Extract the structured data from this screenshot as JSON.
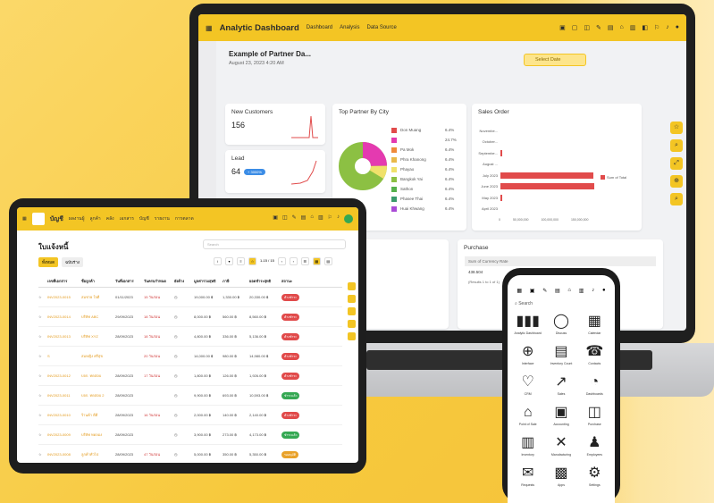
{
  "laptop": {
    "app_title": "Analytic Dashboard",
    "nav": [
      "Dashboard",
      "Analysis",
      "Data Source"
    ],
    "page_title": "Example of Partner Da...",
    "page_date": "August 23, 2023 4:20 AM",
    "select_date": "Select Date",
    "kpi": [
      {
        "label": "New Customers",
        "value": "156"
      },
      {
        "label": "Lead",
        "value": "64",
        "badge": "+ 3000%"
      }
    ],
    "top_partner": {
      "title": "Top Partner By City",
      "items": [
        {
          "name": "Don Muang",
          "pct": "6.4%",
          "color": "#e14b4b"
        },
        {
          "name": "",
          "pct": "24.7%",
          "color": "#e43ab0"
        },
        {
          "name": "Pa Mok",
          "pct": "6.4%",
          "color": "#ef8a3a"
        },
        {
          "name": "Phra Khanong",
          "pct": "6.4%",
          "color": "#e9b94a"
        },
        {
          "name": "Phayao",
          "pct": "6.4%",
          "color": "#f0e16b"
        },
        {
          "name": "Bangkok Yai",
          "pct": "6.4%",
          "color": "#8cc043"
        },
        {
          "name": "Sathon",
          "pct": "6.4%",
          "color": "#56b14c"
        },
        {
          "name": "Phasee Thai",
          "pct": "6.4%",
          "color": "#3a9b6b"
        },
        {
          "name": "Huai Khwang",
          "pct": "6.4%",
          "color": "#a94bd6"
        }
      ]
    },
    "sales_order": {
      "title": "Sales Order",
      "legend": "Sum of Total",
      "categories": [
        "Novembe...",
        "October...",
        "Septembe...",
        "August ...",
        "July 2023",
        "June 2023",
        "May 2023",
        "April 2023"
      ],
      "values": [
        0,
        0,
        2000000,
        0,
        148000000,
        150000000,
        1000000,
        0
      ],
      "ticks": [
        "0",
        "50,000,000",
        "100,000,000",
        "150,000,000"
      ]
    },
    "purchase": {
      "title": "Purchase",
      "label": "Sum of Currency Rate",
      "value": "438.504",
      "rows_text": "(Results 1 to 1 of 1)"
    }
  },
  "tablet": {
    "app_title": "บัญชี",
    "nav": [
      "ผลงานผู้",
      "ลูกค้า",
      "คลัง",
      "เอกสาร",
      "บัญชี",
      "รายงาน",
      "การตลาด"
    ],
    "page_title": "ใบแจ้งหนี้",
    "search_placeholder": "Search",
    "filters": [
      "ทั้งหมด",
      "ฉบับร่าง"
    ],
    "pager": "1-15 / 15",
    "columns": [
      "",
      "เลขที่เอกสาร",
      "ชื่อลูกค้า",
      "วันที่เอกสาร",
      "วันครบกำหนด",
      "ยังค้าง",
      "มูลค่ารวมสุทธิ",
      "ภาษี",
      "ยอดชำระสุทธิ",
      "สถานะ"
    ],
    "rows": [
      {
        "doc": "INV2023-0015",
        "cust": "สมชาย ใจดี",
        "date": "01/11/2023",
        "due": "15 วันก่อน",
        "amount": "19,000.00 ฿",
        "tax": "1,330.00 ฿",
        "net": "20,330.00 ฿",
        "status": "ค้างชำระ",
        "status_color": "#e14b4b"
      },
      {
        "doc": "INV2023-0014",
        "cust": "บริษัท ABC",
        "date": "29/09/2023",
        "due": "18 วันก่อน",
        "amount": "8,000.00 ฿",
        "tax": "560.00 ฿",
        "net": "8,560.00 ฿",
        "status": "ค้างชำระ",
        "status_color": "#e14b4b"
      },
      {
        "doc": "INV2023-0013",
        "cust": "บริษัท XYZ",
        "date": "28/09/2023",
        "due": "18 วันก่อน",
        "amount": "4,800.00 ฿",
        "tax": "336.00 ฿",
        "net": "5,136.00 ฿",
        "status": "ค้างชำระ",
        "status_color": "#e14b4b"
      },
      {
        "doc": "S",
        "cust": "สมหญิง ศรีสุข",
        "date": "",
        "due": "20 วันก่อน",
        "amount": "14,000.00 ฿",
        "tax": "980.00 ฿",
        "net": "14,980.00 ฿",
        "status": "ค้างชำระ",
        "status_color": "#e14b4b"
      },
      {
        "doc": "INV2023-0012",
        "cust": "บจก. ทดสอบ",
        "date": "28/09/2023",
        "due": "17 วันก่อน",
        "amount": "1,800.00 ฿",
        "tax": "126.00 ฿",
        "net": "1,926.00 ฿",
        "status": "ค้างชำระ",
        "status_color": "#e14b4b"
      },
      {
        "doc": "INV2023-0011",
        "cust": "บจก. ทดสอบ 2",
        "date": "28/09/2023",
        "due": "",
        "amount": "9,900.00 ฿",
        "tax": "693.00 ฿",
        "net": "10,593.00 ฿",
        "status": "ชำระแล้ว",
        "status_color": "#35a853"
      },
      {
        "doc": "INV2023-0010",
        "cust": "ร้านค้า ดีดี",
        "date": "28/09/2023",
        "due": "16 วันก่อน",
        "amount": "2,000.00 ฿",
        "tax": "140.00 ฿",
        "net": "2,140.00 ฿",
        "status": "ค้างชำระ",
        "status_color": "#e14b4b"
      },
      {
        "doc": "INV2023-0009",
        "cust": "บริษัท ทดลอง",
        "date": "28/09/2023",
        "due": "",
        "amount": "3,900.00 ฿",
        "tax": "273.00 ฿",
        "net": "4,173.00 ฿",
        "status": "ชำระแล้ว",
        "status_color": "#35a853"
      },
      {
        "doc": "INV2023-0008",
        "cust": "ลูกค้าทั่วไป",
        "date": "28/09/2023",
        "due": "47 วันก่อน",
        "amount": "5,000.00 ฿",
        "tax": "350.00 ฿",
        "net": "5,350.00 ฿",
        "status": "รออนุมัติ",
        "status_color": "#e9a22a"
      },
      {
        "doc": "INV2023-0007",
        "cust": "บริษัท แซมเปิ้ล",
        "date": "28/09/2023",
        "due": "",
        "amount": "4,500.00 ฿",
        "tax": "315.00 ฿",
        "net": "4,815.00 ฿",
        "status": "ชำระแล้ว",
        "status_color": "#35a853"
      }
    ]
  },
  "phone": {
    "search": "Search",
    "apps": [
      {
        "label": "Analytic Dashboard",
        "icon": "▮▮▮"
      },
      {
        "label": "Discuss",
        "icon": "◯"
      },
      {
        "label": "Calendar",
        "icon": "▦"
      },
      {
        "label": "Interface",
        "icon": "⊕"
      },
      {
        "label": "Inventory Count",
        "icon": "▤"
      },
      {
        "label": "Contacts",
        "icon": "☎"
      },
      {
        "label": "CRM",
        "icon": "♡"
      },
      {
        "label": "Sales",
        "icon": "↗"
      },
      {
        "label": "Dashboards",
        "icon": "◔"
      },
      {
        "label": "Point of Sale",
        "icon": "⌂"
      },
      {
        "label": "Accounting",
        "icon": "▣"
      },
      {
        "label": "Purchase",
        "icon": "◫"
      },
      {
        "label": "Inventory",
        "icon": "▥"
      },
      {
        "label": "Manufacturing",
        "icon": "✕"
      },
      {
        "label": "Employees",
        "icon": "♟"
      },
      {
        "label": "Requests",
        "icon": "✉"
      },
      {
        "label": "Apps",
        "icon": "▩"
      },
      {
        "label": "Settings",
        "icon": "⚙"
      }
    ]
  }
}
